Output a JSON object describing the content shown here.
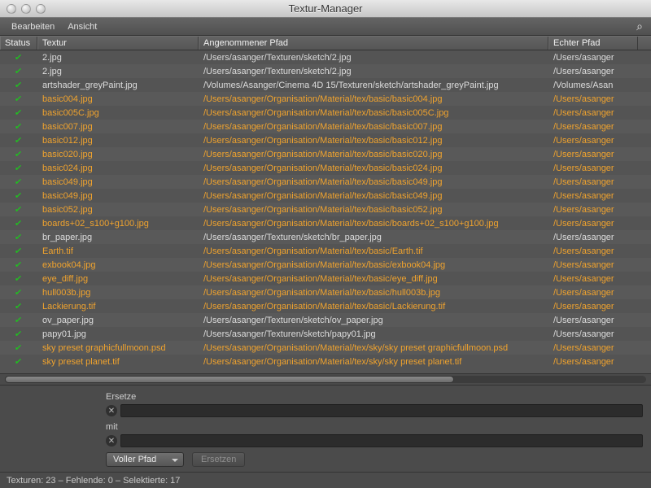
{
  "window": {
    "title": "Textur-Manager"
  },
  "menu": {
    "edit": "Bearbeiten",
    "view": "Ansicht"
  },
  "columns": {
    "status": "Status",
    "textur": "Textur",
    "angen": "Angenommener Pfad",
    "echter": "Echter Pfad"
  },
  "rows": [
    {
      "hl": false,
      "textur": "2.jpg",
      "angen": "/Users/asanger/Texturen/sketch/2.jpg",
      "echter": "/Users/asanger"
    },
    {
      "hl": false,
      "textur": "2.jpg",
      "angen": "/Users/asanger/Texturen/sketch/2.jpg",
      "echter": "/Users/asanger"
    },
    {
      "hl": false,
      "textur": "artshader_greyPaint.jpg",
      "angen": "/Volumes/Asanger/Cinema 4D 15/Texturen/sketch/artshader_greyPaint.jpg",
      "echter": "/Volumes/Asan"
    },
    {
      "hl": true,
      "textur": "basic004.jpg",
      "angen": "/Users/asanger/Organisation/Material/tex/basic/basic004.jpg",
      "echter": "/Users/asanger"
    },
    {
      "hl": true,
      "textur": "basic005C.jpg",
      "angen": "/Users/asanger/Organisation/Material/tex/basic/basic005C.jpg",
      "echter": "/Users/asanger"
    },
    {
      "hl": true,
      "textur": "basic007.jpg",
      "angen": "/Users/asanger/Organisation/Material/tex/basic/basic007.jpg",
      "echter": "/Users/asanger"
    },
    {
      "hl": true,
      "textur": "basic012.jpg",
      "angen": "/Users/asanger/Organisation/Material/tex/basic/basic012.jpg",
      "echter": "/Users/asanger"
    },
    {
      "hl": true,
      "textur": "basic020.jpg",
      "angen": "/Users/asanger/Organisation/Material/tex/basic/basic020.jpg",
      "echter": "/Users/asanger"
    },
    {
      "hl": true,
      "textur": "basic024.jpg",
      "angen": "/Users/asanger/Organisation/Material/tex/basic/basic024.jpg",
      "echter": "/Users/asanger"
    },
    {
      "hl": true,
      "textur": "basic049.jpg",
      "angen": "/Users/asanger/Organisation/Material/tex/basic/basic049.jpg",
      "echter": "/Users/asanger"
    },
    {
      "hl": true,
      "textur": "basic049.jpg",
      "angen": "/Users/asanger/Organisation/Material/tex/basic/basic049.jpg",
      "echter": "/Users/asanger"
    },
    {
      "hl": true,
      "textur": "basic052.jpg",
      "angen": "/Users/asanger/Organisation/Material/tex/basic/basic052.jpg",
      "echter": "/Users/asanger"
    },
    {
      "hl": true,
      "textur": "boards+02_s100+g100.jpg",
      "angen": "/Users/asanger/Organisation/Material/tex/basic/boards+02_s100+g100.jpg",
      "echter": "/Users/asanger"
    },
    {
      "hl": false,
      "textur": "br_paper.jpg",
      "angen": "/Users/asanger/Texturen/sketch/br_paper.jpg",
      "echter": "/Users/asanger"
    },
    {
      "hl": true,
      "textur": "Earth.tif",
      "angen": "/Users/asanger/Organisation/Material/tex/basic/Earth.tif",
      "echter": "/Users/asanger"
    },
    {
      "hl": true,
      "textur": "exbook04.jpg",
      "angen": "/Users/asanger/Organisation/Material/tex/basic/exbook04.jpg",
      "echter": "/Users/asanger"
    },
    {
      "hl": true,
      "textur": "eye_diff.jpg",
      "angen": "/Users/asanger/Organisation/Material/tex/basic/eye_diff.jpg",
      "echter": "/Users/asanger"
    },
    {
      "hl": true,
      "textur": "hull003b.jpg",
      "angen": "/Users/asanger/Organisation/Material/tex/basic/hull003b.jpg",
      "echter": "/Users/asanger"
    },
    {
      "hl": true,
      "textur": "Lackierung.tif",
      "angen": "/Users/asanger/Organisation/Material/tex/basic/Lackierung.tif",
      "echter": "/Users/asanger"
    },
    {
      "hl": false,
      "textur": "ov_paper.jpg",
      "angen": "/Users/asanger/Texturen/sketch/ov_paper.jpg",
      "echter": "/Users/asanger"
    },
    {
      "hl": false,
      "textur": "papy01.jpg",
      "angen": "/Users/asanger/Texturen/sketch/papy01.jpg",
      "echter": "/Users/asanger"
    },
    {
      "hl": true,
      "textur": "sky preset graphicfullmoon.psd",
      "angen": "/Users/asanger/Organisation/Material/tex/sky/sky preset graphicfullmoon.psd",
      "echter": "/Users/asanger"
    },
    {
      "hl": true,
      "textur": "sky preset planet.tif",
      "angen": "/Users/asanger/Organisation/Material/tex/sky/sky preset planet.tif",
      "echter": "/Users/asanger"
    }
  ],
  "replace": {
    "ersetze_label": "Ersetze",
    "mit_label": "mit",
    "mode": "Voller Pfad",
    "button": "Ersetzen"
  },
  "status": "Texturen: 23 – Fehlende: 0 – Selektierte: 17"
}
